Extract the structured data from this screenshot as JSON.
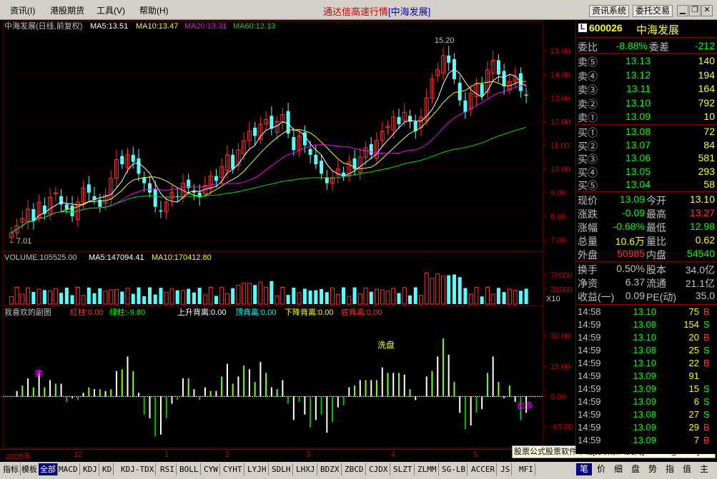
{
  "menu": {
    "items": [
      "资讯(I)",
      "港股期货",
      "工具(V)",
      "帮助(H)"
    ]
  },
  "app_title": {
    "main": "通达信高速行情",
    "bracket": "[中海发展]"
  },
  "toolbar": {
    "news": "资讯系统",
    "trade": "委托交易"
  },
  "window_buttons": {
    "minimize": "▁",
    "restore": "❐",
    "close": "✕"
  },
  "colors": {
    "up": "#ff3232",
    "down": "#54ffff",
    "ma5": "#ffffff",
    "ma10": "#ffff00",
    "ma20": "#ff00ff",
    "ma60": "#00e000",
    "grid": "#800000",
    "axis_text": "#d00000"
  },
  "kline": {
    "title": "中海发展(日线,前复权)",
    "ma5_label": "MA5:13.51",
    "ma10_label": "MA10:13.47",
    "ma20_label": "MA20:13.31",
    "ma60_label": "MA60:12.13",
    "high_mark": "15.20",
    "low_mark": "←7.01",
    "y_ticks": [
      "15.00",
      "14.00",
      "13.00",
      "12.00",
      "11.00",
      "10.00",
      "9.00",
      "8.00",
      "7.00"
    ]
  },
  "volume": {
    "label": "VOLUME:105525.00",
    "ma5_label": "MA5:147094.41",
    "ma10_label": "MA10:170412.80",
    "y_ticks": [
      "70000",
      "35000"
    ],
    "unit": "X10"
  },
  "sub": {
    "title": "我喜欢的副图",
    "red": "红柱:0.00",
    "green": "绿柱:-9.80",
    "up_div": "上升背离:0.00",
    "top_div": "顶背离:0.00",
    "down_div": "下降背离:0.00",
    "bottom_div": "底背离:0.00",
    "y_ticks": [
      "30.00",
      "15.00",
      "0.00",
      "-15.00"
    ],
    "labels": [
      {
        "t": "卖",
        "c": "#ff00ff"
      },
      {
        "t": "洗盘",
        "c": "#ffff00"
      },
      {
        "t": "买",
        "c": "#00ff00"
      },
      {
        "t": "卖多",
        "c": "#ff00ff"
      }
    ]
  },
  "date_axis": [
    "2008年",
    "12",
    "1",
    "2",
    "3",
    "4",
    "5"
  ],
  "watermark": "股票公式股票软件下载[分析家公式网]www.88gs.com]",
  "quote": {
    "code": "600026",
    "name": "中海发展",
    "wb_label": "委比",
    "wb": "-8.88%",
    "wc_label": "委差",
    "wc": "-212",
    "asks": [
      {
        "label": "卖⑤",
        "price": "13.13",
        "vol": "140"
      },
      {
        "label": "卖④",
        "price": "13.12",
        "vol": "194"
      },
      {
        "label": "卖③",
        "price": "13.11",
        "vol": "164"
      },
      {
        "label": "卖②",
        "price": "13.10",
        "vol": "792"
      },
      {
        "label": "卖①",
        "price": "13.09",
        "vol": "10"
      }
    ],
    "bids": [
      {
        "label": "买①",
        "price": "13.08",
        "vol": "72"
      },
      {
        "label": "买②",
        "price": "13.07",
        "vol": "84"
      },
      {
        "label": "买③",
        "price": "13.06",
        "vol": "581"
      },
      {
        "label": "买④",
        "price": "13.05",
        "vol": "293"
      },
      {
        "label": "买⑤",
        "price": "13.04",
        "vol": "58"
      }
    ],
    "stats": [
      {
        "l1": "现价",
        "v1": "13.09",
        "c1": "#00ff00",
        "l2": "今开",
        "v2": "13.10",
        "c2": "#ffff00"
      },
      {
        "l1": "涨跌",
        "v1": "-0.09",
        "c1": "#00ff00",
        "l2": "最高",
        "v2": "13.27",
        "c2": "#ff3232"
      },
      {
        "l1": "涨幅",
        "v1": "-0.68%",
        "c1": "#00ff00",
        "l2": "最低",
        "v2": "12.98",
        "c2": "#00ff00"
      },
      {
        "l1": "总量",
        "v1": "10.6万",
        "c1": "#ffff00",
        "l2": "量比",
        "v2": "0.62",
        "c2": "#ffff00"
      },
      {
        "l1": "外盘",
        "v1": "50985",
        "c1": "#ff3232",
        "l2": "内盘",
        "v2": "54540",
        "c2": "#00ff00"
      }
    ],
    "stats2": [
      {
        "l1": "换手",
        "v1": "0.50%",
        "l2": "股本",
        "v2": "34.0亿"
      },
      {
        "l1": "净资",
        "v1": "6.37",
        "l2": "流通",
        "v2": "21.1亿"
      },
      {
        "l1": "收益(一)",
        "v1": "0.09",
        "l2": "PE(动)",
        "v2": "35.0"
      }
    ],
    "ticks": [
      {
        "time": "14:58",
        "price": "13.10",
        "vol": "75",
        "bs": "B"
      },
      {
        "time": "14:59",
        "price": "13.08",
        "vol": "154",
        "bs": "S"
      },
      {
        "time": "14:59",
        "price": "13.10",
        "vol": "20",
        "bs": "B"
      },
      {
        "time": "14:59",
        "price": "13.08",
        "vol": "25",
        "bs": "S"
      },
      {
        "time": "14:59",
        "price": "13.10",
        "vol": "22",
        "bs": "B"
      },
      {
        "time": "14:59",
        "price": "13.09",
        "vol": "91",
        "bs": ""
      },
      {
        "time": "14:59",
        "price": "13.09",
        "vol": "15",
        "bs": "S"
      },
      {
        "time": "14:59",
        "price": "13.09",
        "vol": "6",
        "bs": "S"
      },
      {
        "time": "14:59",
        "price": "13.08",
        "vol": "27",
        "bs": "S"
      },
      {
        "time": "14:59",
        "price": "13.09",
        "vol": "29",
        "bs": "B"
      },
      {
        "time": "14:59",
        "price": "13.09",
        "vol": "7",
        "bs": "B"
      }
    ]
  },
  "bottom_tabs": [
    "指标",
    "模板",
    "全部",
    "MACD",
    "KDJ",
    "KD",
    "KDJ-TDX",
    "RSI",
    "BOLL",
    "CYW",
    "CYHT",
    "LYJH",
    "SDLH",
    "LHXJ",
    "BDZX",
    "ZBCD",
    "CJDX",
    "SLZT",
    "ZLMM",
    "SG-LB",
    "ACCER",
    "JS",
    "MFI"
  ],
  "right_tabs": [
    "笔",
    "价",
    "细",
    "盘",
    "势",
    "指",
    "值",
    "主"
  ],
  "chart_data": {
    "type": "candlestick",
    "title": "中海发展(日线,前复权)",
    "period_labels": [
      "2008年",
      "12",
      "1",
      "2",
      "3",
      "4",
      "5"
    ],
    "ylim": [
      6.7,
      15.7
    ],
    "high": 15.2,
    "low": 7.01,
    "ma_last": {
      "MA5": 13.51,
      "MA10": 13.47,
      "MA20": 13.31,
      "MA60": 12.13
    },
    "closes": [
      7.3,
      7.6,
      7.9,
      8.3,
      7.8,
      8.6,
      8.1,
      8.8,
      9.0,
      8.5,
      8.3,
      8.0,
      8.6,
      9.2,
      9.0,
      8.7,
      8.4,
      8.9,
      9.6,
      10.4,
      10.2,
      10.6,
      10.3,
      9.8,
      9.4,
      9.0,
      8.4,
      8.2,
      8.6,
      9.0,
      8.8,
      9.4,
      9.2,
      9.0,
      8.8,
      9.3,
      9.7,
      9.5,
      10.1,
      10.6,
      10.0,
      10.8,
      11.2,
      11.6,
      11.4,
      11.9,
      12.1,
      11.7,
      12.0,
      12.3,
      11.5,
      10.8,
      11.4,
      11.0,
      10.6,
      10.2,
      9.8,
      9.4,
      9.6,
      10.0,
      9.7,
      10.3,
      10.0,
      10.5,
      10.9,
      10.6,
      11.2,
      11.6,
      11.8,
      12.2,
      11.9,
      12.4,
      12.0,
      11.6,
      12.2,
      13.0,
      13.8,
      14.2,
      14.8,
      14.5,
      13.8,
      12.9,
      12.4,
      13.2,
      13.6,
      13.1,
      14.2,
      14.6,
      14.0,
      13.5,
      13.7,
      13.9,
      13.3,
      13.1
    ],
    "volume_last": 105525,
    "volume_ma5": 147094.41,
    "volume_ma10": 170412.8,
    "sub_ylim": [
      -25,
      38
    ]
  }
}
